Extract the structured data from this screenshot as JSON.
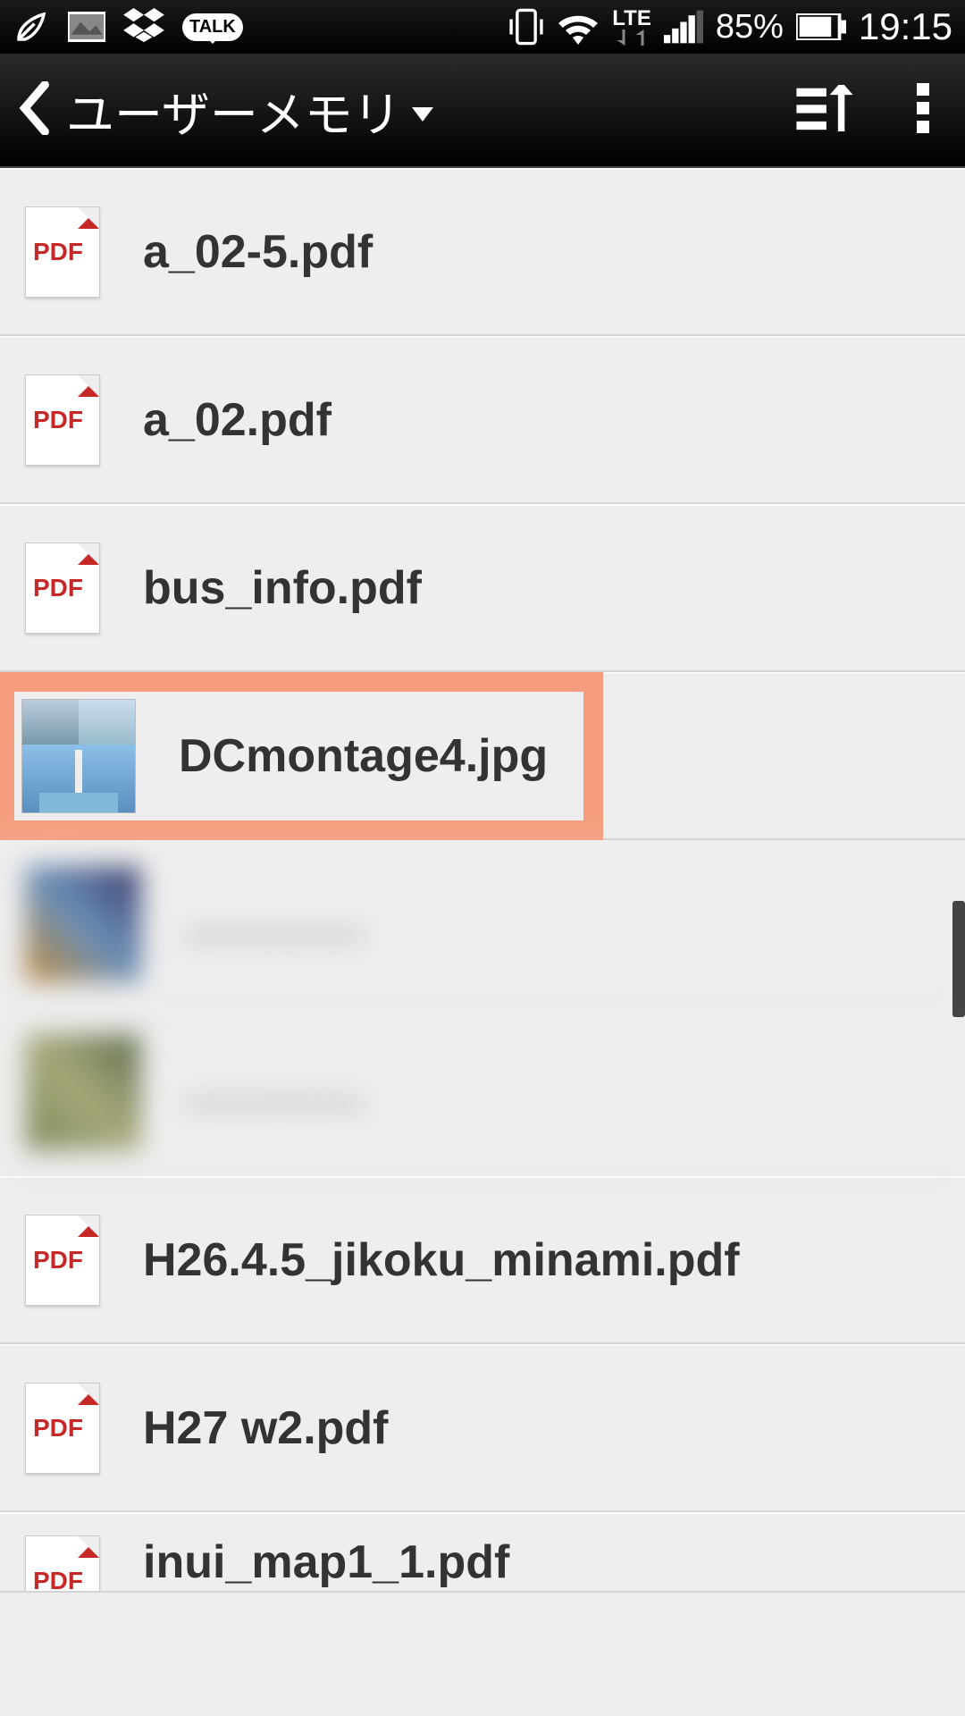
{
  "status_bar": {
    "network_label": "LTE",
    "battery_percent": "85%",
    "time": "19:15",
    "talk_label": "TALK"
  },
  "header": {
    "title": "ユーザーメモリ"
  },
  "files": [
    {
      "name": "a_02-5.pdf",
      "type": "pdf"
    },
    {
      "name": "a_02.pdf",
      "type": "pdf"
    },
    {
      "name": "bus_info.pdf",
      "type": "pdf"
    },
    {
      "name": "DCmontage4.jpg",
      "type": "image",
      "highlighted": true
    },
    {
      "name": "",
      "type": "image",
      "blurred": true
    },
    {
      "name": "",
      "type": "image",
      "blurred": true
    },
    {
      "name": "H26.4.5_jikoku_minami.pdf",
      "type": "pdf"
    },
    {
      "name": "H27 w2.pdf",
      "type": "pdf"
    },
    {
      "name": "inui_map1_1.pdf",
      "type": "pdf",
      "partial": true
    }
  ]
}
